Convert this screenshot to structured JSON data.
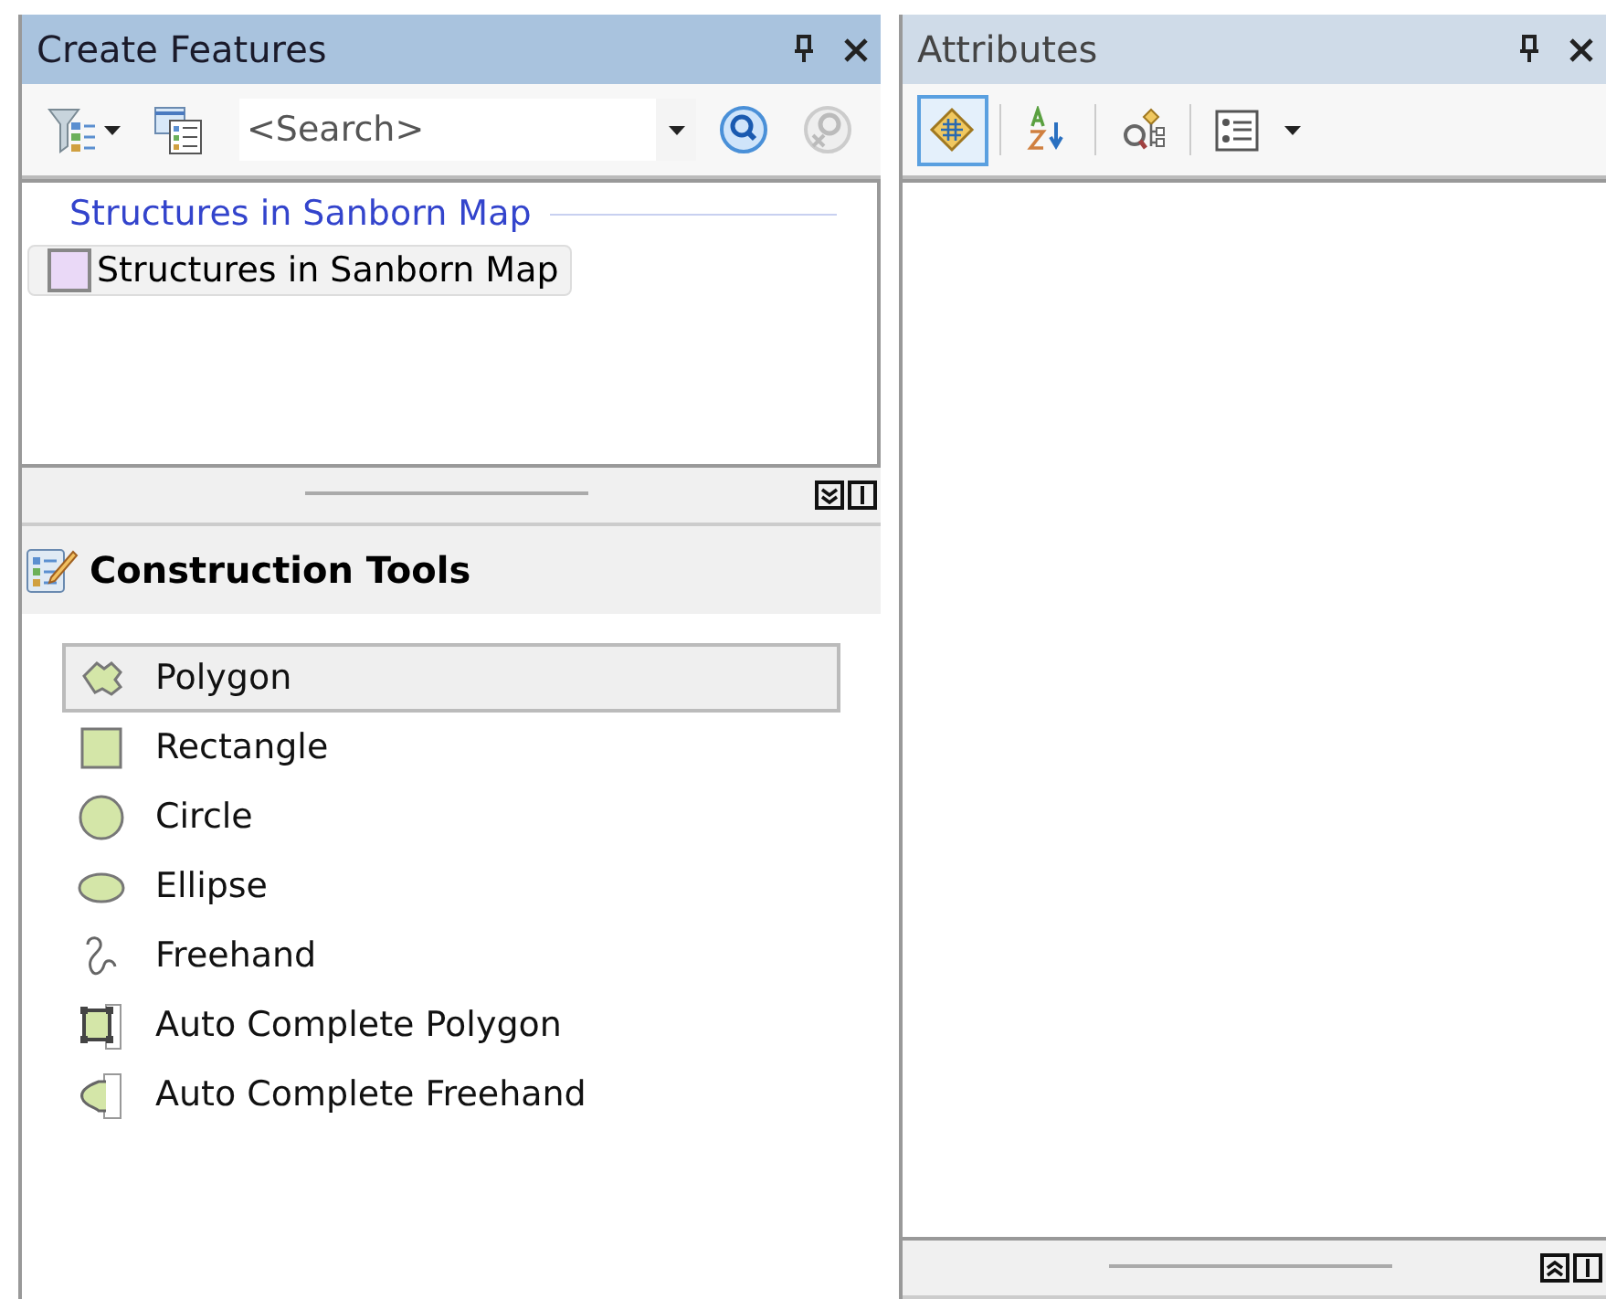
{
  "create_features": {
    "title": "Create Features",
    "search": {
      "placeholder": "<Search>"
    },
    "template_group": {
      "label": "Structures in Sanborn Map"
    },
    "templates": [
      {
        "label": "Structures in Sanborn Map"
      }
    ],
    "construction_tools": {
      "title": "Construction Tools",
      "tools": [
        {
          "label": "Polygon",
          "kind": "polygon",
          "selected": true
        },
        {
          "label": "Rectangle",
          "kind": "rectangle",
          "selected": false
        },
        {
          "label": "Circle",
          "kind": "circle",
          "selected": false
        },
        {
          "label": "Ellipse",
          "kind": "ellipse",
          "selected": false
        },
        {
          "label": "Freehand",
          "kind": "freehand",
          "selected": false
        },
        {
          "label": "Auto Complete Polygon",
          "kind": "auto-polygon",
          "selected": false
        },
        {
          "label": "Auto Complete Freehand",
          "kind": "auto-freehand",
          "selected": false
        }
      ]
    }
  },
  "attributes": {
    "title": "Attributes",
    "toolbar": [
      {
        "kind": "layers",
        "selected": true
      },
      {
        "kind": "sort",
        "selected": false
      },
      {
        "kind": "related",
        "selected": false
      },
      {
        "kind": "list",
        "selected": false
      }
    ]
  }
}
